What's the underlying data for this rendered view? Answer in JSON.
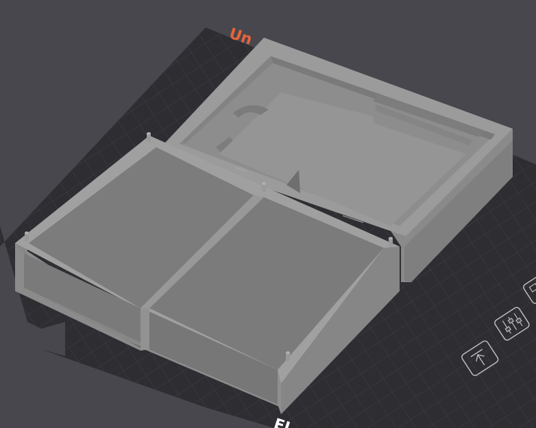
{
  "viewport": {
    "background_color": "#48474d",
    "bed_color": "#2f2e33",
    "grid_color": "#3c3b41",
    "model_color": "#8f8f8f",
    "bed_label_top": "Un",
    "bed_label_top_color": "#e8643a",
    "bed_label_bottom": "EL",
    "bed_label_bottom_color": "#ffffff"
  },
  "toolbar": {
    "icons": [
      "arrange-icon",
      "adjust-icon",
      "export-icon"
    ]
  }
}
